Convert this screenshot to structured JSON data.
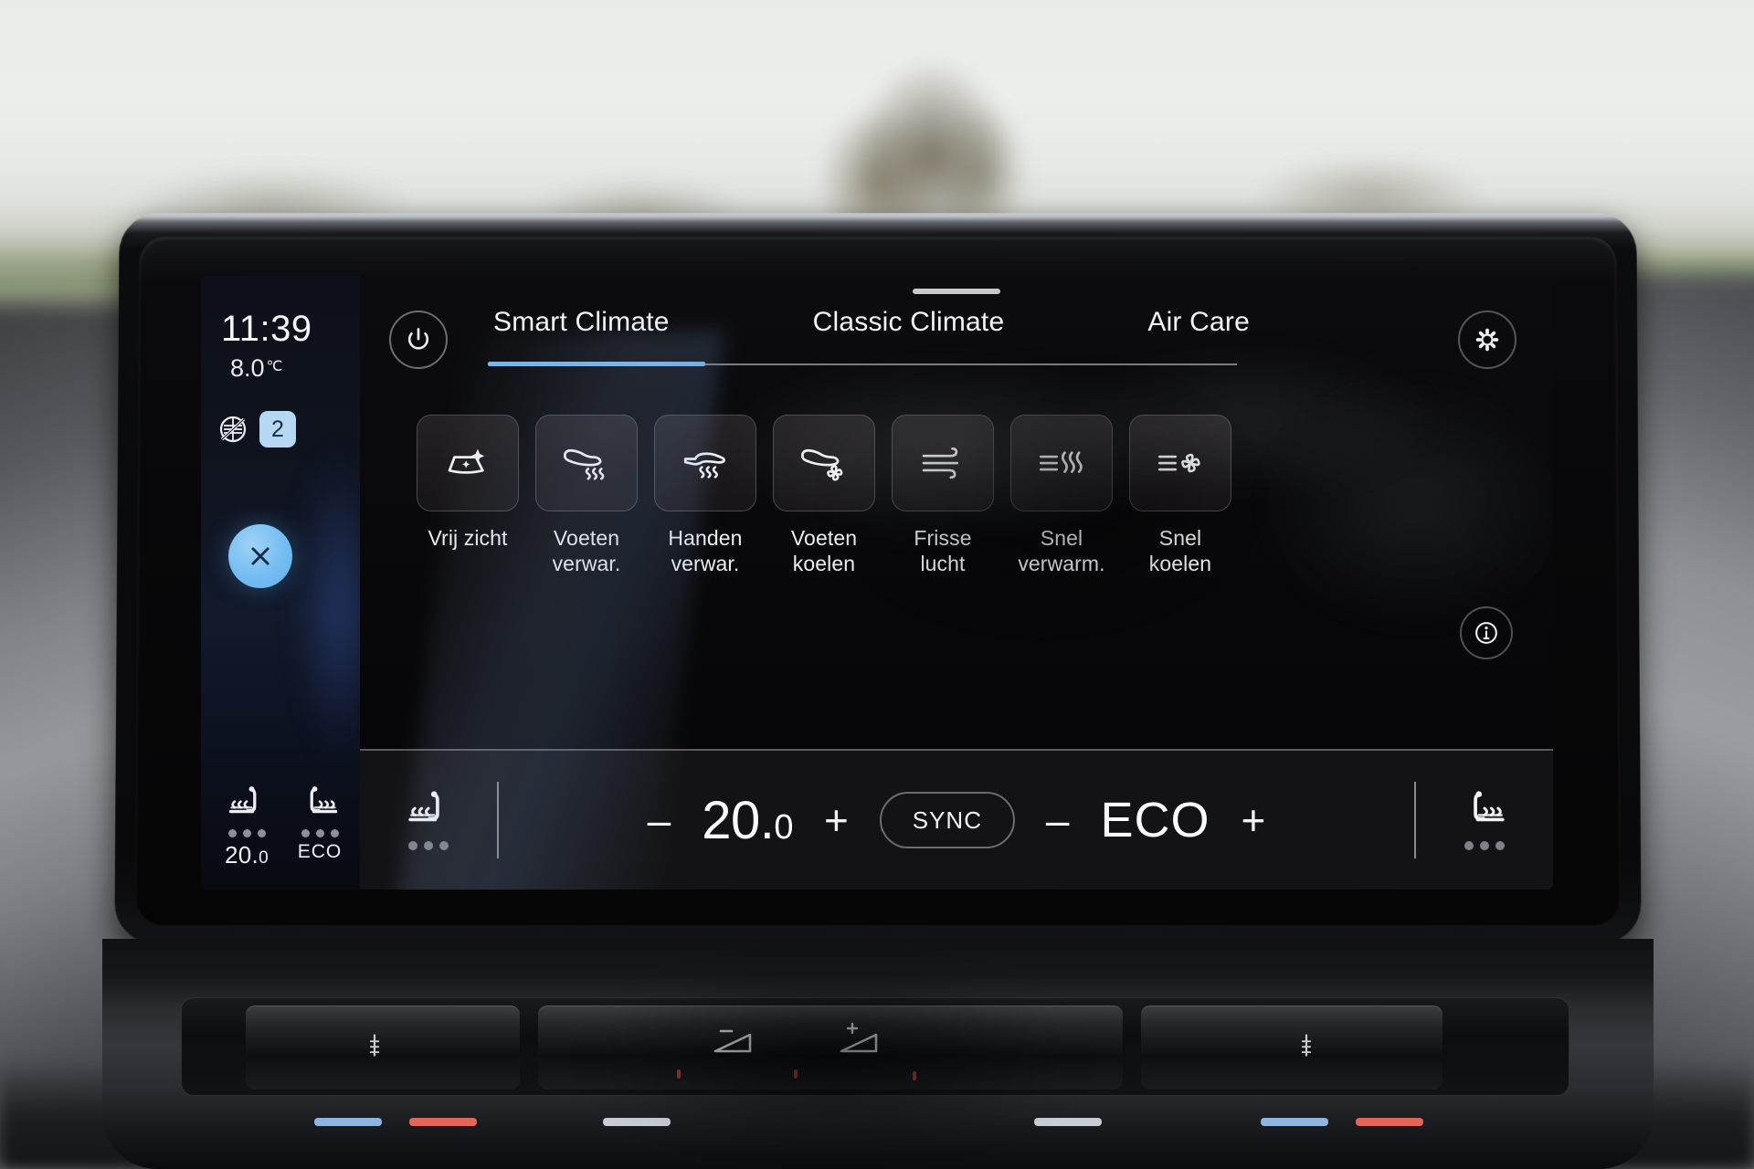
{
  "device": {
    "name": "vw-id-infotainment-screen"
  },
  "sidebar": {
    "clock": "11:39",
    "outside_temp": "8.0",
    "outside_temp_unit": "℃",
    "recirculation_icon": "recirculation-off-icon",
    "fan_level": "2",
    "close_icon": "close-x-icon",
    "seats": [
      {
        "icon": "seat-heat-icon",
        "value": "20.",
        "value_dec": "0",
        "dots": 3
      },
      {
        "icon": "seat-heat-icon",
        "value": "ECO",
        "value_dec": "",
        "dots": 3
      }
    ]
  },
  "header": {
    "power_icon": "power-icon",
    "gear_icon": "gear-icon",
    "tabs": [
      {
        "label": "Smart Climate",
        "active": true
      },
      {
        "label": "Classic Climate",
        "active": false
      },
      {
        "label": "Air Care",
        "active": false
      }
    ],
    "active_tab_color": "#79b4e8"
  },
  "tiles": [
    {
      "label_line1": "Vrij zicht",
      "label_line2": "",
      "icon": "defrost-windscreen-icon"
    },
    {
      "label_line1": "Voeten",
      "label_line2": "verwar.",
      "icon": "feet-heat-icon"
    },
    {
      "label_line1": "Handen",
      "label_line2": "verwar.",
      "icon": "hand-heat-icon"
    },
    {
      "label_line1": "Voeten",
      "label_line2": "koelen",
      "icon": "feet-cool-icon"
    },
    {
      "label_line1": "Frisse",
      "label_line2": "lucht",
      "icon": "fresh-air-icon"
    },
    {
      "label_line1": "Snel",
      "label_line2": "verwarm.",
      "icon": "quick-heat-icon"
    },
    {
      "label_line1": "Snel",
      "label_line2": "koelen",
      "icon": "quick-cool-icon"
    }
  ],
  "info_button": {
    "icon": "info-icon"
  },
  "climate_bar": {
    "left_seat_icon": "seat-heat-icon",
    "left_seat_dots": 3,
    "minus": "–",
    "plus": "+",
    "temperature": "20.",
    "temperature_dec": "0",
    "sync_label": "SYNC",
    "eco_label": "ECO",
    "right_seat_icon": "seat-heat-icon",
    "right_seat_dots": 3
  },
  "physical_controls": {
    "power_icon": "power-icon",
    "left_seat_icon": "seat-heat-slider-icon",
    "right_seat_icon": "seat-heat-slider-icon",
    "volume_down_icon": "volume-down-icon",
    "volume_up_icon": "volume-up-icon",
    "color_bars": [
      "#8fb4dd",
      "#e0665c",
      "#c9ccd2",
      "#c9ccd2",
      "#8fb4dd",
      "#e0665c"
    ]
  }
}
